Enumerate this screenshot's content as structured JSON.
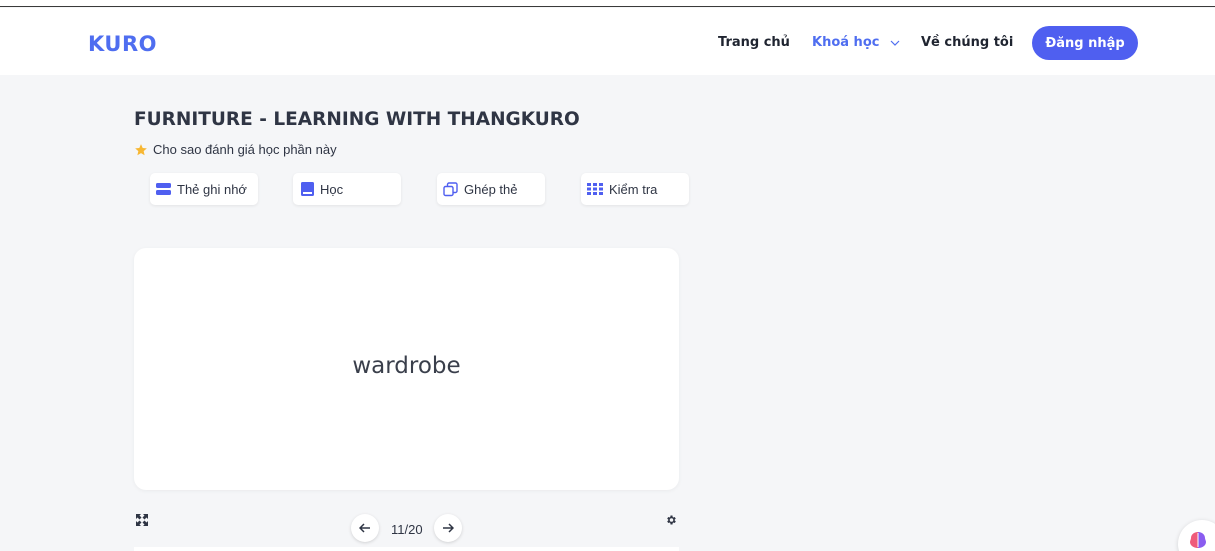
{
  "navbar": {
    "logo": "KURO",
    "links": [
      "Trang chủ",
      "Khoá học",
      "Về chúng tôi"
    ],
    "login_label": "Đăng nhập"
  },
  "set": {
    "title": "FURNITURE - LEARNING WITH THANGKURO",
    "rating_prompt": "Cho sao đánh giá học phần này"
  },
  "modes": [
    {
      "label": "Thẻ ghi nhớ",
      "icon": "cards-icon"
    },
    {
      "label": "Học",
      "icon": "book-icon"
    },
    {
      "label": "Ghép thẻ",
      "icon": "copy-icon"
    },
    {
      "label": "Kiểm tra",
      "icon": "grid-icon"
    }
  ],
  "flashcard": {
    "term": "wardrobe",
    "counter": "11/20"
  },
  "colors": {
    "accent": "#4f6ef0",
    "button": "#4f5ff0",
    "background": "#f5f6f8",
    "star": "#f7b733"
  }
}
